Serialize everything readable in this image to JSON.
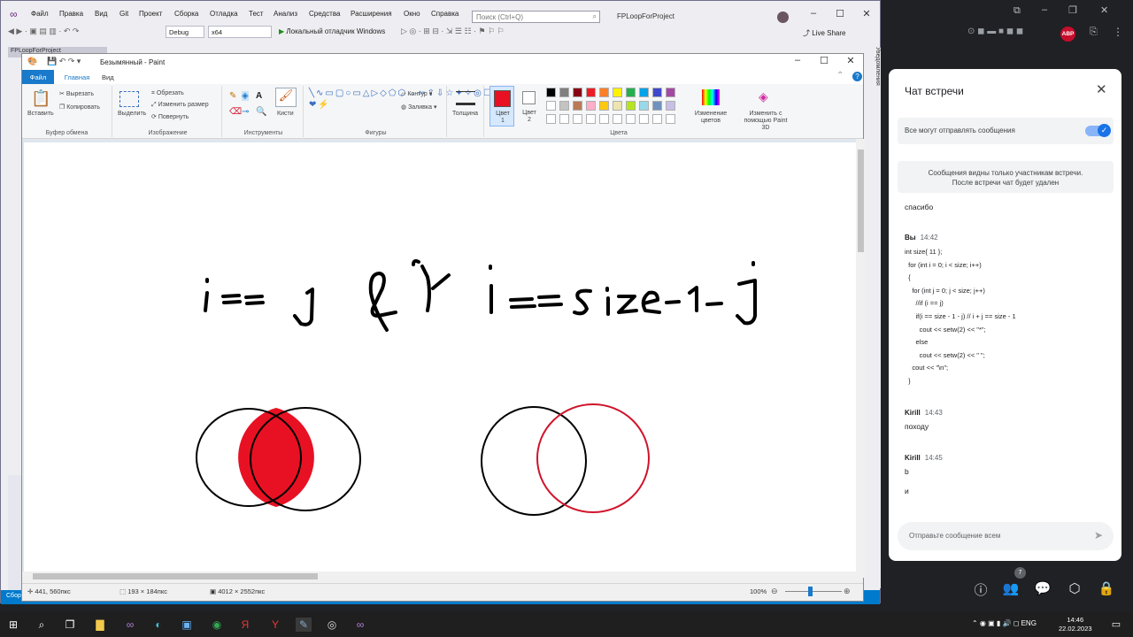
{
  "vs": {
    "menu": [
      "Файл",
      "Правка",
      "Вид",
      "Git",
      "Проект",
      "Сборка",
      "Отладка",
      "Тест",
      "Анализ",
      "Средства",
      "Расширения",
      "Окно",
      "Справка"
    ],
    "search_placeholder": "Поиск (Ctrl+Q)",
    "project_name": "FPLoopForProject",
    "config": "Debug",
    "platform": "x64",
    "run_label": "Локальный отладчик Windows",
    "liveshare": "Live Share",
    "tab_label": "FPLoopForProject",
    "right_rail": "Уведомления",
    "status_text": "Сборка успешно завершено"
  },
  "paint": {
    "title": "Безымянный - Paint",
    "tabs": {
      "file": "Файл",
      "home": "Главная",
      "view": "Вид"
    },
    "clipboard": {
      "paste": "Вставить",
      "cut": "Вырезать",
      "copy": "Копировать",
      "label": "Буфер обмена"
    },
    "image": {
      "select": "Выделить",
      "crop": "Обрезать",
      "resize": "Изменить размер",
      "rotate": "Повернуть",
      "label": "Изображение"
    },
    "tools": {
      "brushes": "Кисти",
      "label": "Инструменты"
    },
    "shapes": {
      "outline": "Контур",
      "fill": "Заливка",
      "label": "Фигуры"
    },
    "size": {
      "label": "Толщина"
    },
    "colors": {
      "color1": "Цвет 1",
      "color2": "Цвет 2",
      "edit": "Изменение цветов",
      "paint3d": "Изменить с помощью Paint 3D",
      "label": "Цвета",
      "color1_value": "#e81123",
      "color2_value": "#ffffff",
      "palette": [
        "#000000",
        "#7f7f7f",
        "#880015",
        "#ed1c24",
        "#ff7f27",
        "#fff200",
        "#22b14c",
        "#00a2e8",
        "#3f48cc",
        "#a349a4",
        "#ffffff",
        "#c3c3c3",
        "#b97a57",
        "#ffaec9",
        "#ffc90e",
        "#efe4b0",
        "#b5e61d",
        "#99d9ea",
        "#7092be",
        "#c8bfe7"
      ]
    },
    "canvas": {
      "venn_intersection_color": "#e81123",
      "venn_right_circle_color": "#d0142c"
    },
    "status": {
      "cursor": "441, 560пкс",
      "selection": "193 × 184пкс",
      "image_size": "4012 × 2552пкс",
      "zoom": "100%"
    }
  },
  "chat": {
    "title": "Чат встречи",
    "toggle_label": "Все могут отправлять сообщения",
    "toggle_on": true,
    "notice_line1": "Сообщения видны только участникам встречи.",
    "notice_line2": "После встречи чат будет удален",
    "msg0_text": "спасибо",
    "msg1": {
      "sender": "Вы",
      "time": "14:42",
      "code": [
        "int size{ 11 };",
        "  for (int i = 0; i < size; i++)",
        "  {",
        "    for (int j = 0; j < size; j++)",
        "      //if (i == j)",
        "      if(i == size - 1 - j) // i + j == size - 1",
        "        cout << setw(2) << \"*\";",
        "      else",
        "        cout << setw(2) << \" \";",
        "    cout << \"\\n\";",
        "  }"
      ]
    },
    "msg2": {
      "sender": "Kirill",
      "time": "14:43",
      "text": "походу"
    },
    "msg3": {
      "sender": "Kirill",
      "time": "14:45",
      "text": "b",
      "text2": "и"
    },
    "input_placeholder": "Отправьте сообщение всем",
    "people_badge": "7"
  },
  "browser": {
    "abp_label": "ABP"
  },
  "taskbar": {
    "lang": "ENG",
    "time": "14:46",
    "date": "22.02.2023"
  }
}
